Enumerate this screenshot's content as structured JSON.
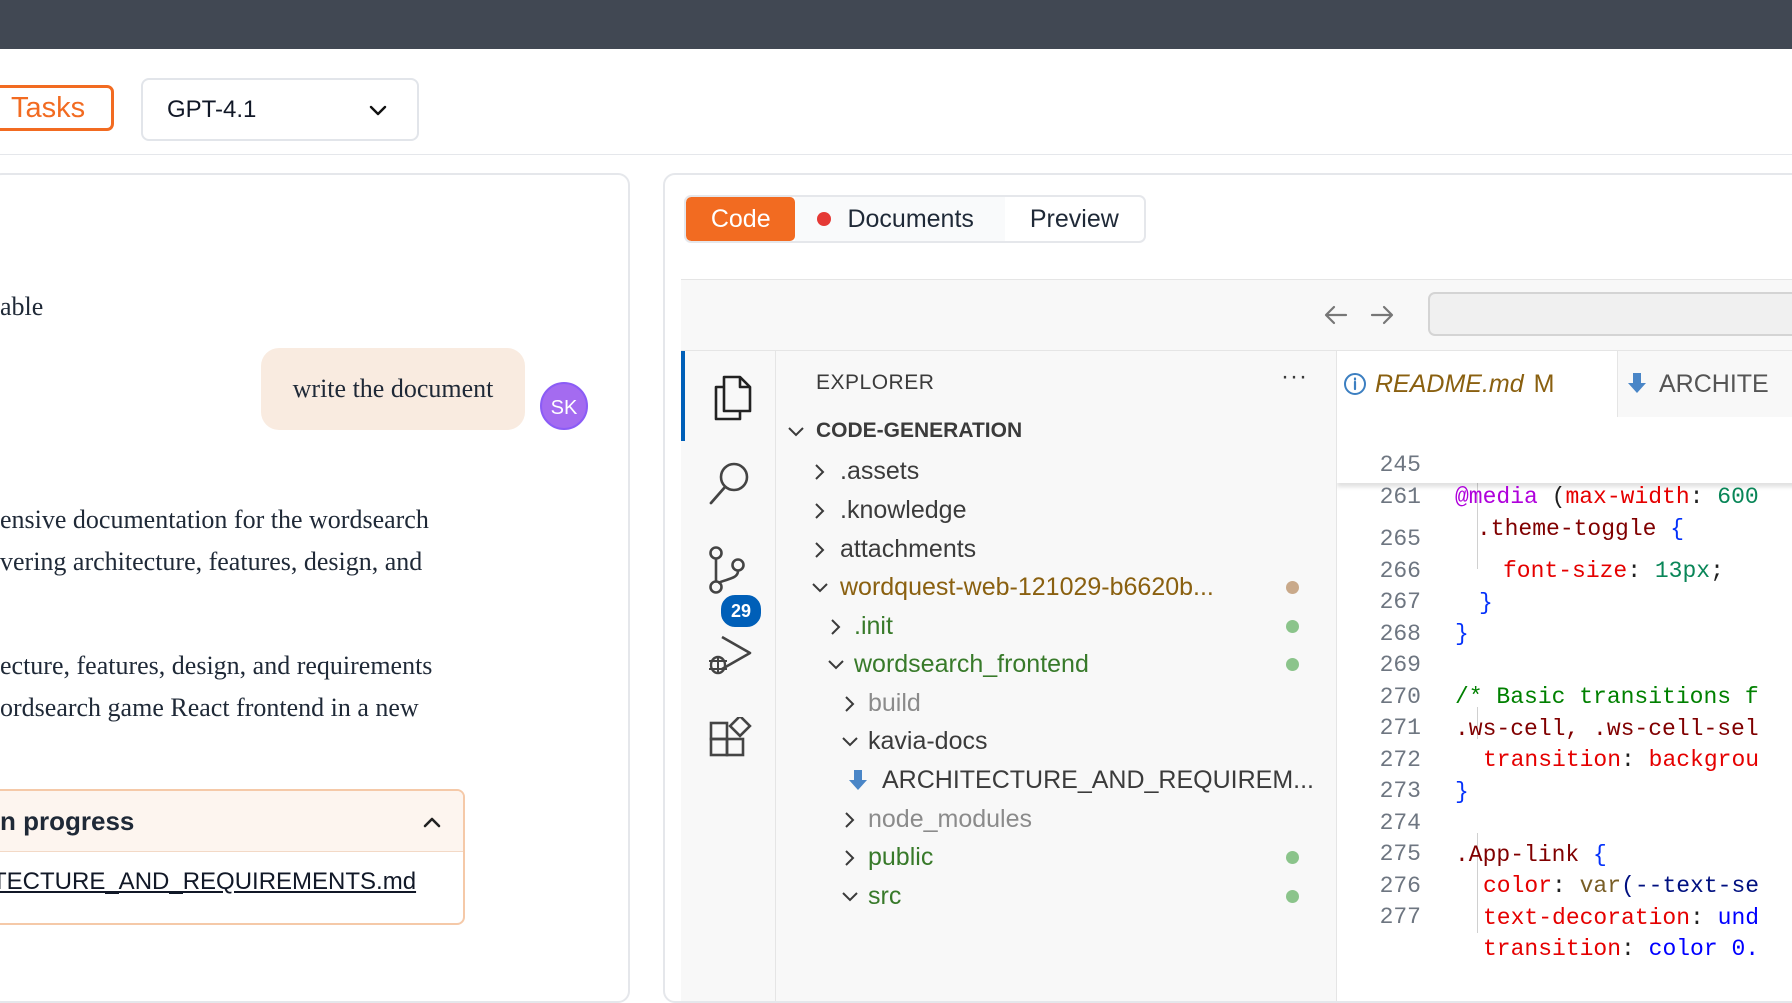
{
  "toolbar": {
    "tasks_label": "Tasks",
    "model_value": "GPT-4.1"
  },
  "chat": {
    "line_fragment": "able",
    "user_message": "write the document",
    "user_initials": "SK",
    "assistant_lines": [
      "ensive documentation for the wordsearch",
      "vering architecture, features, design, and",
      "ecture, features, design, and requirements",
      "ordsearch game React frontend in a new"
    ],
    "progress_title": "n progress",
    "progress_file": "TECTURE_AND_REQUIREMENTS.md"
  },
  "panel_tabs": {
    "code": "Code",
    "documents": "Documents",
    "preview": "Preview"
  },
  "explorer": {
    "title": "EXPLORER",
    "more": "···",
    "root": "CODE-GENERATION",
    "source_control_badge": "29",
    "items": [
      {
        "label": ".assets"
      },
      {
        "label": ".knowledge"
      },
      {
        "label": "attachments"
      },
      {
        "label": "wordquest-web-121029-b6620b..."
      },
      {
        "label": ".init"
      },
      {
        "label": "wordsearch_frontend"
      },
      {
        "label": "build"
      },
      {
        "label": "kavia-docs"
      },
      {
        "label": "ARCHITECTURE_AND_REQUIREM..."
      },
      {
        "label": "node_modules"
      },
      {
        "label": "public"
      },
      {
        "label": "src"
      }
    ]
  },
  "editor": {
    "tab1_name": "README.md",
    "tab1_status": "M",
    "tab2_name": "ARCHITE",
    "sticky": [
      {
        "num": "245",
        "at": "@media",
        "rest_open": " (",
        "prop": "max-width",
        "colon": ": ",
        "val": "600"
      },
      {
        "num": "261",
        "sel": ".theme-toggle",
        "brace": " {"
      }
    ],
    "lines": [
      {
        "num": "265",
        "prop": "font-size",
        "colon": ": ",
        "val": "13px",
        "end": ";"
      },
      {
        "num": "266",
        "brace": "}"
      },
      {
        "num": "267",
        "brace": "}"
      },
      {
        "num": "268"
      },
      {
        "num": "269",
        "comment": "/* Basic transitions f"
      },
      {
        "num": "270",
        "sel": ".ws-cell, .ws-cell-sel"
      },
      {
        "num": "271",
        "prop": "transition",
        "colon": ": ",
        "val": "backgrou"
      },
      {
        "num": "272",
        "brace": "}"
      },
      {
        "num": "273"
      },
      {
        "num": "274",
        "sel": ".App-link",
        "brace": " {"
      },
      {
        "num": "275",
        "prop": "color",
        "colon": ": ",
        "fn": "var",
        "val": "(--text-se"
      },
      {
        "num": "276",
        "prop": "text-decoration",
        "colon": ": ",
        "val": "und"
      },
      {
        "num": "277",
        "prop": "transition",
        "colon": ": ",
        "val": "color 0."
      }
    ]
  },
  "colors": {
    "accent": "#f26b21",
    "git_green": "#387a2a",
    "git_modified": "#8a6010",
    "vscode_blue": "#005fb8"
  }
}
